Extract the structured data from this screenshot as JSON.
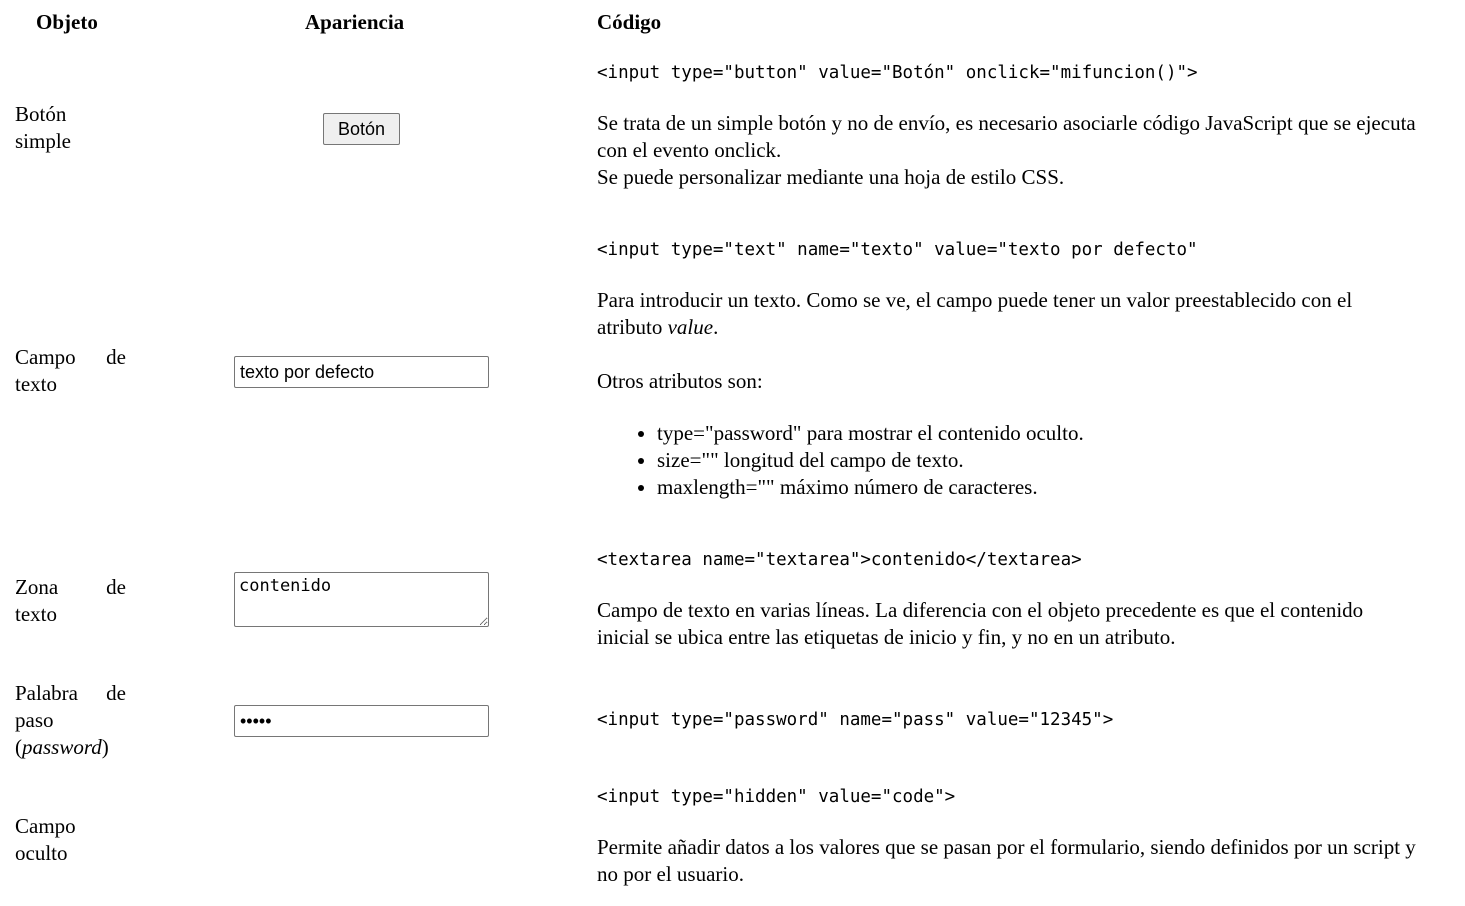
{
  "headers": {
    "object": "Objeto",
    "appearance": "Apariencia",
    "code": "Código"
  },
  "rows": {
    "button": {
      "object_line1": "Botón",
      "object_line2": "simple",
      "control_label": "Botón",
      "code": "<input type=\"button\" value=\"Botón\" onclick=\"mifuncion()\">",
      "desc1": "Se trata de un simple botón y no de envío, es necesario asociarle código JavaScript que se ejecuta con el evento onclick.",
      "desc2": "Se puede personalizar mediante una hoja de estilo CSS."
    },
    "text": {
      "object_line1": "Campo de",
      "object_line2": "texto",
      "control_value": "texto por defecto",
      "code": "<input type=\"text\" name=\"texto\" value=\"texto por defecto\"",
      "desc1_pre": "Para introducir un texto. Como se ve, el campo puede tener un valor preestablecido con el atributo ",
      "desc1_em": "value",
      "desc1_post": ".",
      "desc2": "Otros atributos son:",
      "attributes": [
        "type=\"password\" para mostrar el contenido oculto.",
        "size=\"\" longitud del campo de texto.",
        "maxlength=\"\" máximo número de caracteres."
      ]
    },
    "textarea": {
      "object_line1": "Zona de",
      "object_line2": "texto",
      "control_value": "contenido",
      "code": "<textarea name=\"textarea\">contenido</textarea>",
      "desc": "Campo de texto en varias líneas. La diferencia con el objeto precedente es que el contenido inicial se ubica entre las etiquetas de inicio y fin, y no en un atributo."
    },
    "password": {
      "object_line1": "Palabra de",
      "object_line2": "paso",
      "object_line3_pre": "(",
      "object_line3_em": "password",
      "object_line3_post": ")",
      "control_value": "12345",
      "code": "<input type=\"password\" name=\"pass\" value=\"12345\">"
    },
    "hidden": {
      "object_line1": "Campo",
      "object_line2": "oculto",
      "code": "<input type=\"hidden\" value=\"code\">",
      "desc": "Permite añadir datos a los valores que se pasan por el formulario, siendo definidos por un script y no por el usuario."
    }
  }
}
